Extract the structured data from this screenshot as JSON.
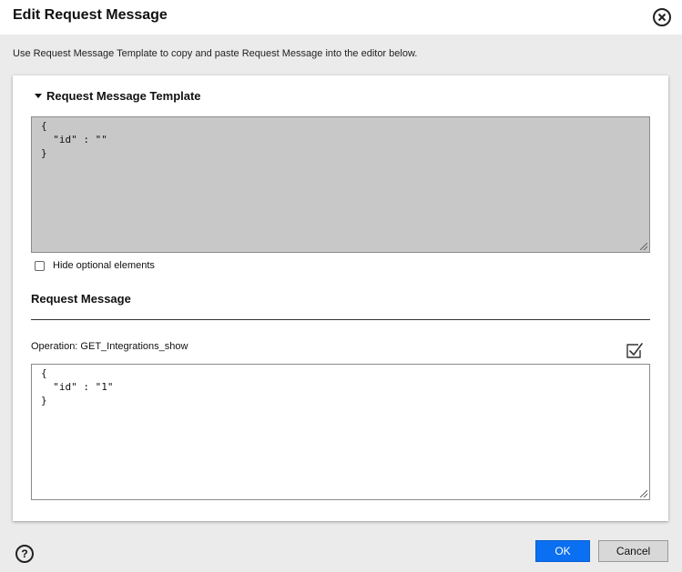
{
  "dialog": {
    "title": "Edit Request Message",
    "instructions": "Use Request Message Template to copy and paste Request Message into the editor below."
  },
  "template_section": {
    "label": "Request Message Template",
    "expanded": true,
    "code": "{\n  \"id\" : \"\"\n}"
  },
  "hide_optional": {
    "label": "Hide optional elements",
    "checked": false
  },
  "request_message": {
    "heading": "Request Message",
    "operation": "Operation: GET_Integrations_show",
    "code": "{\n  \"id\" : \"1\"\n}"
  },
  "footer": {
    "help_glyph": "?",
    "ok_label": "OK",
    "cancel_label": "Cancel"
  },
  "colors": {
    "primary_button": "#0a6ff0",
    "template_background": "#c8c8c8"
  }
}
